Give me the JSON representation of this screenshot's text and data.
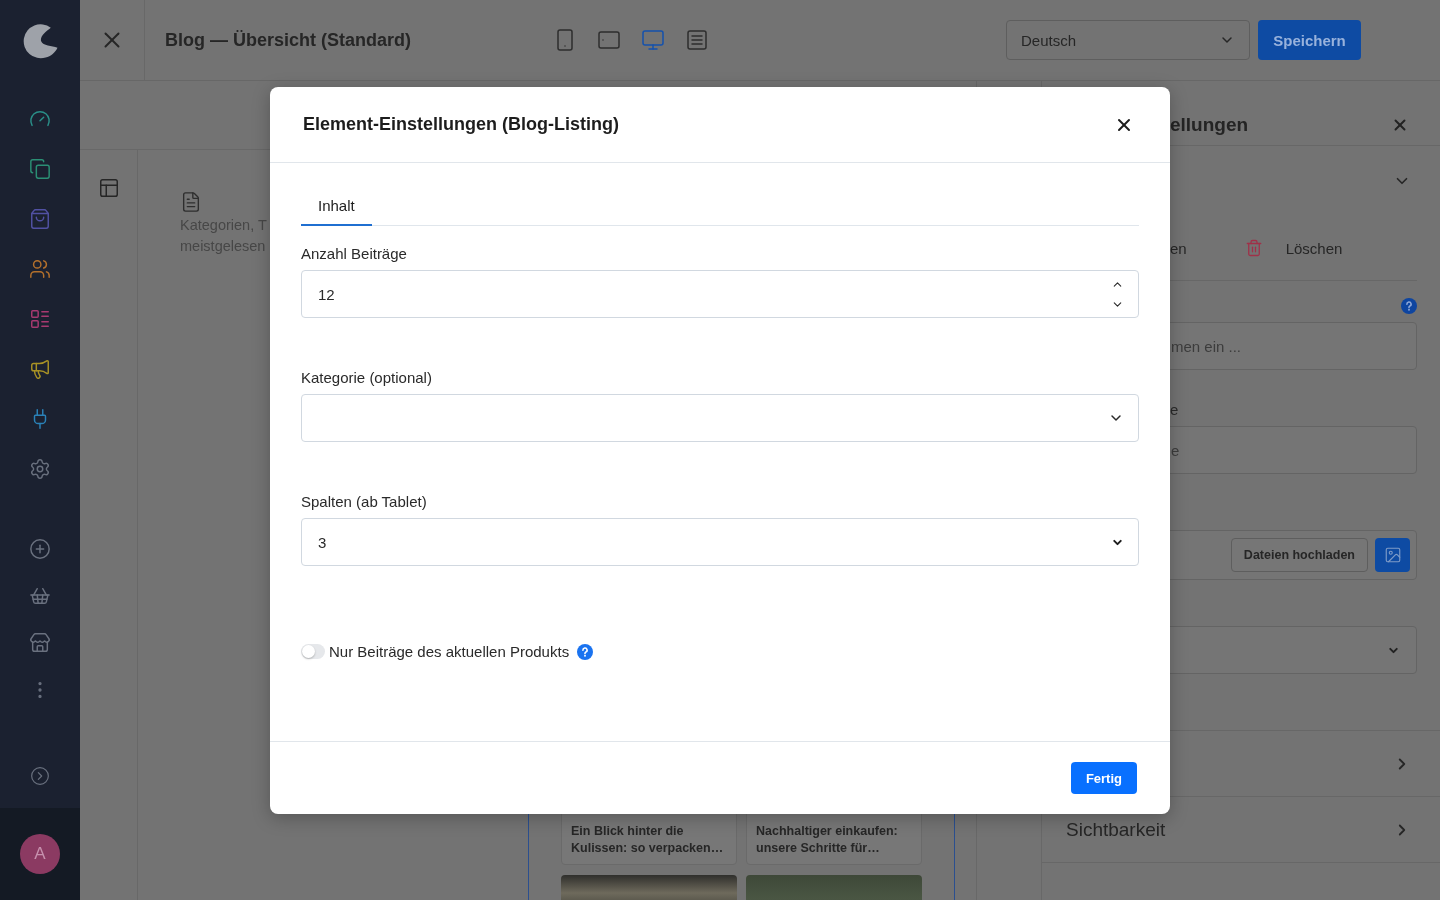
{
  "sidebar": {
    "avatar": "A"
  },
  "topbar": {
    "title": "Blog — Übersicht (Standard)",
    "viewports": [
      {
        "kind": "mobile",
        "selected": false
      },
      {
        "kind": "tablet",
        "selected": false
      },
      {
        "kind": "desktop",
        "selected": true
      },
      {
        "kind": "form",
        "selected": false
      }
    ],
    "language": "Deutsch",
    "save_button": "Speichern"
  },
  "editor": {
    "block_description": [
      "Kategorien, T",
      "meistgelesen"
    ],
    "cards": [
      {
        "title": "Ein Blick hinter die Kulissen: so verpacken…"
      },
      {
        "title": "Nachhaltiger einkaufen: unsere Schritte für…"
      }
    ]
  },
  "settings_panel": {
    "title": "ellungen",
    "general_section": {
      "expanded": true
    },
    "actions": [
      {
        "kind": "text",
        "label": "en"
      },
      {
        "kind": "delete",
        "label": "Löschen"
      }
    ],
    "name_field": {
      "placeholder": "men ein ..."
    },
    "caption_field": {
      "label": "e",
      "placeholder": "e"
    },
    "upload_button": "Dateien hochladen",
    "sections": [
      {
        "expanded": false
      },
      {
        "title": "Sichtbarkeit",
        "expanded": false
      }
    ]
  },
  "dialog": {
    "title": "Element-Einstellungen (Blog-Listing)",
    "tabs": [
      {
        "label": "Inhalt",
        "selected": true
      }
    ],
    "fields": [
      {
        "kind": "number",
        "label": "Anzahl Beiträge",
        "value": "12"
      },
      {
        "kind": "combobox",
        "label": "Kategorie (optional)"
      },
      {
        "kind": "select",
        "label": "Spalten (ab Tablet)",
        "value": "3"
      }
    ],
    "toggle": {
      "label": "Nur Beiträge des aktuellen Produkts",
      "on": false
    },
    "done_button": "Fertig"
  }
}
